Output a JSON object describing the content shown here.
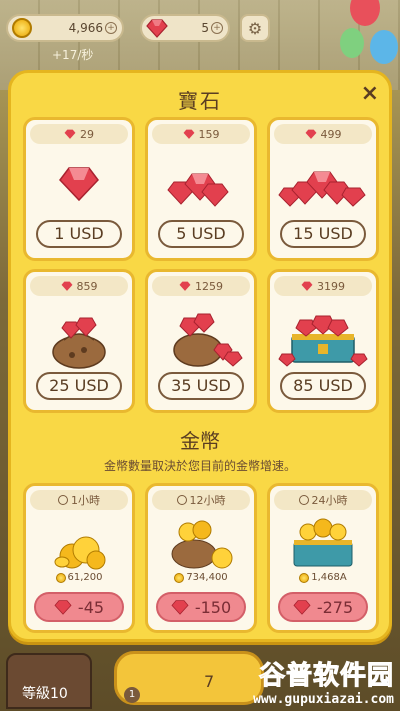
{
  "hud": {
    "coins": "4,966",
    "gems": "5",
    "rate": "+17/秒",
    "plus": "+"
  },
  "modal": {
    "title": "寶石",
    "close": "×",
    "gem_packs": [
      {
        "amount": "29",
        "price": "1 USD",
        "art": "gem-single"
      },
      {
        "amount": "159",
        "price": "5 USD",
        "art": "gem-pile-small"
      },
      {
        "amount": "499",
        "price": "15 USD",
        "art": "gem-pile-large"
      },
      {
        "amount": "859",
        "price": "25 USD",
        "art": "gem-bag"
      },
      {
        "amount": "1259",
        "price": "35 USD",
        "art": "gem-bag-overflow"
      },
      {
        "amount": "3199",
        "price": "85 USD",
        "art": "gem-chest"
      }
    ],
    "gold_title": "金幣",
    "gold_desc": "金幣數量取決於您目前的金幣增速。",
    "gold_packs": [
      {
        "duration": "1小時",
        "coins": "61,200",
        "cost": "-45"
      },
      {
        "duration": "12小時",
        "coins": "734,400",
        "cost": "-150"
      },
      {
        "duration": "24小時",
        "coins": "1,468A",
        "cost": "-275"
      }
    ]
  },
  "bottom": {
    "level": "等級10",
    "badge": "1",
    "center_count": "7"
  },
  "watermark": {
    "name": "谷普软件园",
    "url": "www.gupuxiazai.com"
  },
  "colors": {
    "modal_bg": "#f9d845",
    "card_bg": "#fdf8ea",
    "gem_red": "#e2404e",
    "gem_button": "#f0898f"
  }
}
